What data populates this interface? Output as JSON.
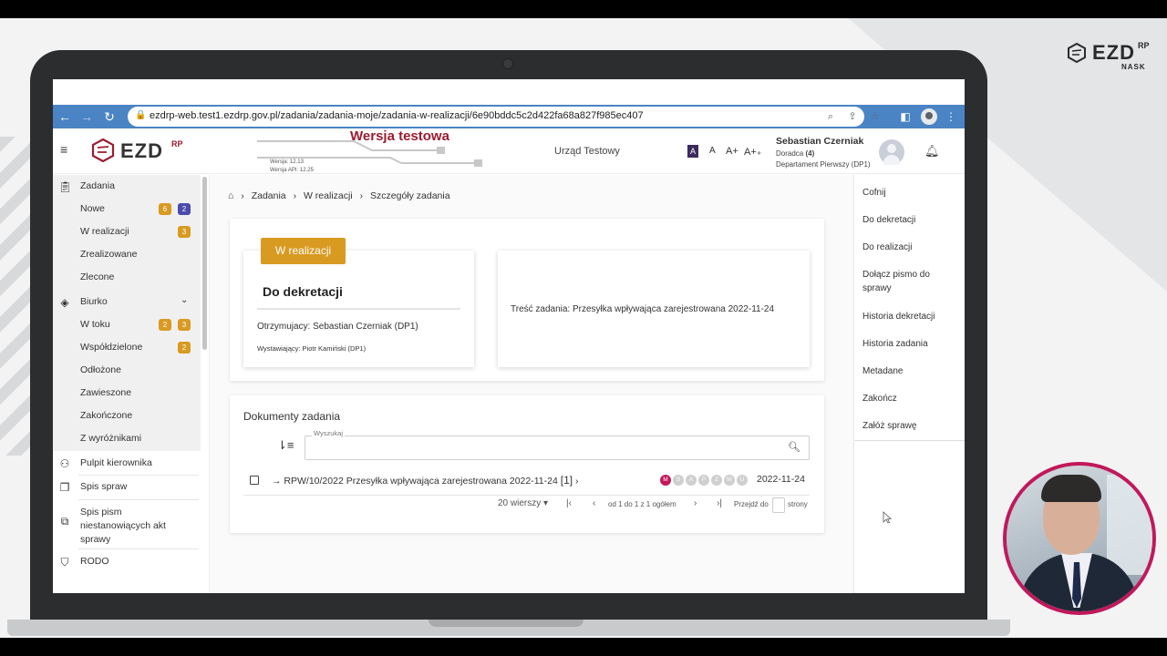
{
  "brand": {
    "name": "EZD",
    "sup": "RP",
    "org": "NASK"
  },
  "browser": {
    "url": "ezdrp-web.test1.ezdrp.gov.pl/zadania/zadania-moje/zadania-w-realizacji/6e90bddc5c2d422fa68a827f985ec407"
  },
  "header": {
    "logo_text": "EZD",
    "logo_sup": "RP",
    "test_label": "Wersja testowa",
    "version": "Wersja: 12.13",
    "version_api": "Wersja API: 12.25",
    "office": "Urząd Testowy",
    "font_sizes": [
      "A",
      "A",
      "A+",
      "A+₊"
    ],
    "user_name": "Sebastian Czerniak",
    "user_role_prefix": "Doradca",
    "user_role_count": "(4)",
    "user_dept": "Departament Pierwszy (DP1)"
  },
  "sidebar": {
    "zadania": {
      "label": "Zadania",
      "items": [
        {
          "label": "Nowe",
          "badges": [
            "6",
            "2"
          ]
        },
        {
          "label": "W realizacji",
          "badges": [
            "3"
          ]
        },
        {
          "label": "Zrealizowane",
          "badges": []
        },
        {
          "label": "Zlecone",
          "badges": []
        }
      ]
    },
    "biurko": {
      "label": "Biurko",
      "items": [
        {
          "label": "W toku",
          "badges": [
            "2",
            "3"
          ]
        },
        {
          "label": "Współdzielone",
          "badges": [
            "2"
          ]
        },
        {
          "label": "Odłożone",
          "badges": []
        },
        {
          "label": "Zawieszone",
          "badges": []
        },
        {
          "label": "Zakończone",
          "badges": []
        },
        {
          "label": "Z wyróżnikami",
          "badges": []
        }
      ]
    },
    "pulpit": "Pulpit kierownika",
    "spis_spraw": "Spis spraw",
    "spis_pism": "Spis pism niestanowiących akt sprawy",
    "rodo": "RODO"
  },
  "breadcrumb": [
    "Zadania",
    "W realizacji",
    "Szczegóły zadania"
  ],
  "task": {
    "status": "W realizacji",
    "title": "Do dekretacji",
    "recipient": "Otrzymujacy: Sebastian Czerniak (DP1)",
    "issuer": "Wystawiający: Piotr Kamiński (DP1)",
    "content": "Treść zadania: Przesyłka wpływająca zarejestrowana 2022-11-24"
  },
  "documents": {
    "title": "Dokumenty zadania",
    "search_label": "Wyszukaj",
    "rows": [
      {
        "signature": "RPW/10/2022",
        "description": "Przesyłka wpływająca zarejestrowana 2022-11-24",
        "count": "[1]",
        "stamps": [
          "M",
          "S",
          "A",
          "P",
          "Z",
          "W",
          "U"
        ],
        "date": "2022-11-24"
      }
    ],
    "page_size": "20 wierszy",
    "range": "od 1 do 1 z 1 ogółem",
    "goto": "Przejdź do",
    "goto_suffix": "strony"
  },
  "actions": [
    "Cofnij",
    "Do dekretacji",
    "Do realizacji",
    "Dołącz pismo do sprawy",
    "Historia dekretacji",
    "Historia zadania",
    "Metadane",
    "Zakończ",
    "Załóż sprawę"
  ],
  "colors": {
    "accent": "#9b1b30",
    "status": "#d99a21",
    "badge_purple": "#4a4bab",
    "browser_bar": "#4a84c4",
    "webcam_ring": "#c2185b"
  }
}
